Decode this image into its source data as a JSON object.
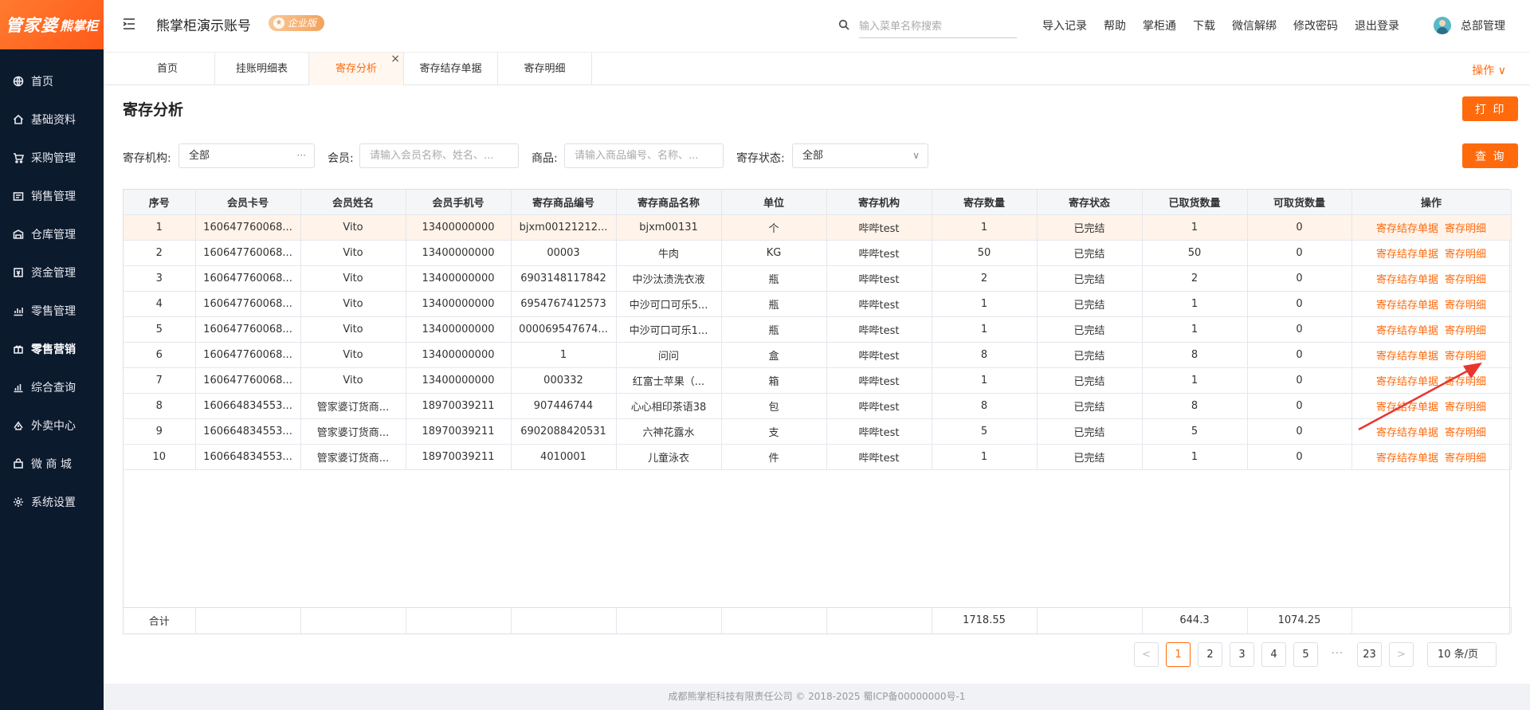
{
  "brand": {
    "logo_main": "管家婆",
    "logo_sub": "熊掌柜"
  },
  "sidebar": {
    "items": [
      {
        "label": "首页",
        "icon": "globe-icon"
      },
      {
        "label": "基础资料",
        "icon": "home-icon"
      },
      {
        "label": "采购管理",
        "icon": "cart-icon"
      },
      {
        "label": "销售管理",
        "icon": "sales-icon"
      },
      {
        "label": "仓库管理",
        "icon": "warehouse-icon"
      },
      {
        "label": "资金管理",
        "icon": "money-icon"
      },
      {
        "label": "零售管理",
        "icon": "chart-icon"
      },
      {
        "label": "零售营销",
        "icon": "gift-icon",
        "active": true
      },
      {
        "label": "综合查询",
        "icon": "bar-chart-icon"
      },
      {
        "label": "外卖中心",
        "icon": "delivery-icon"
      },
      {
        "label": "微 商 城",
        "icon": "shop-icon"
      },
      {
        "label": "系统设置",
        "icon": "gear-icon"
      }
    ]
  },
  "header": {
    "account_title": "熊掌柜演示账号",
    "badge": "企业版",
    "search_placeholder": "输入菜单名称搜索",
    "links": [
      "导入记录",
      "帮助",
      "掌柜通",
      "下载",
      "微信解绑",
      "修改密码",
      "退出登录"
    ],
    "user_name": "总部管理"
  },
  "tabs": {
    "items": [
      "首页",
      "挂账明细表",
      "寄存分析",
      "寄存结存单据",
      "寄存明细"
    ],
    "active_index": 2,
    "ops_label": "操作 ∨"
  },
  "page": {
    "title": "寄存分析",
    "print_label": "打 印",
    "query_label": "查 询"
  },
  "filters": {
    "org_label": "寄存机构:",
    "org_value": "全部",
    "member_label": "会员:",
    "member_placeholder": "请输入会员名称、姓名、...",
    "goods_label": "商品:",
    "goods_placeholder": "请输入商品编号、名称、...",
    "status_label": "寄存状态:",
    "status_value": "全部"
  },
  "table": {
    "columns": [
      "序号",
      "会员卡号",
      "会员姓名",
      "会员手机号",
      "寄存商品编号",
      "寄存商品名称",
      "单位",
      "寄存机构",
      "寄存数量",
      "寄存状态",
      "已取货数量",
      "可取货数量",
      "操作"
    ],
    "op_links": [
      "寄存结存单据",
      "寄存明细"
    ],
    "rows": [
      [
        "1",
        "160647760068...",
        "Vito",
        "13400000000",
        "bjxm00121212...",
        "bjxm00131",
        "个",
        "哔哔test",
        "1",
        "已完结",
        "1",
        "0"
      ],
      [
        "2",
        "160647760068...",
        "Vito",
        "13400000000",
        "00003",
        "牛肉",
        "KG",
        "哔哔test",
        "50",
        "已完结",
        "50",
        "0"
      ],
      [
        "3",
        "160647760068...",
        "Vito",
        "13400000000",
        "6903148117842",
        "中沙汰渍洗衣液",
        "瓶",
        "哔哔test",
        "2",
        "已完结",
        "2",
        "0"
      ],
      [
        "4",
        "160647760068...",
        "Vito",
        "13400000000",
        "6954767412573",
        "中沙可口可乐5...",
        "瓶",
        "哔哔test",
        "1",
        "已完结",
        "1",
        "0"
      ],
      [
        "5",
        "160647760068...",
        "Vito",
        "13400000000",
        "000069547674...",
        "中沙可口可乐1...",
        "瓶",
        "哔哔test",
        "1",
        "已完结",
        "1",
        "0"
      ],
      [
        "6",
        "160647760068...",
        "Vito",
        "13400000000",
        "1",
        "问问",
        "盒",
        "哔哔test",
        "8",
        "已完结",
        "8",
        "0"
      ],
      [
        "7",
        "160647760068...",
        "Vito",
        "13400000000",
        "000332",
        "红富士苹果（...",
        "箱",
        "哔哔test",
        "1",
        "已完结",
        "1",
        "0"
      ],
      [
        "8",
        "160664834553...",
        "管家婆订货商...",
        "18970039211",
        "907446744",
        "心心相印茶语38",
        "包",
        "哔哔test",
        "8",
        "已完结",
        "8",
        "0"
      ],
      [
        "9",
        "160664834553...",
        "管家婆订货商...",
        "18970039211",
        "6902088420531",
        "六神花露水",
        "支",
        "哔哔test",
        "5",
        "已完结",
        "5",
        "0"
      ],
      [
        "10",
        "160664834553...",
        "管家婆订货商...",
        "18970039211",
        "4010001",
        "儿童泳衣",
        "件",
        "哔哔test",
        "1",
        "已完结",
        "1",
        "0"
      ]
    ],
    "total": {
      "label": "合计",
      "qty": "1718.55",
      "taken": "644.3",
      "available": "1074.25"
    }
  },
  "pagination": {
    "prev": "<",
    "pages": [
      "1",
      "2",
      "3",
      "4",
      "5"
    ],
    "ellipsis": "···",
    "last": "23",
    "next": ">",
    "page_size": "10 条/页",
    "current": "1"
  },
  "footer": {
    "text": "成都熊掌柜科技有限责任公司 © 2018-2025 蜀ICP备00000000号-1"
  },
  "colors": {
    "accent": "#ff6a0d",
    "sidebar_bg": "#0c1a2e",
    "annotation_arrow": "#e8362e"
  }
}
